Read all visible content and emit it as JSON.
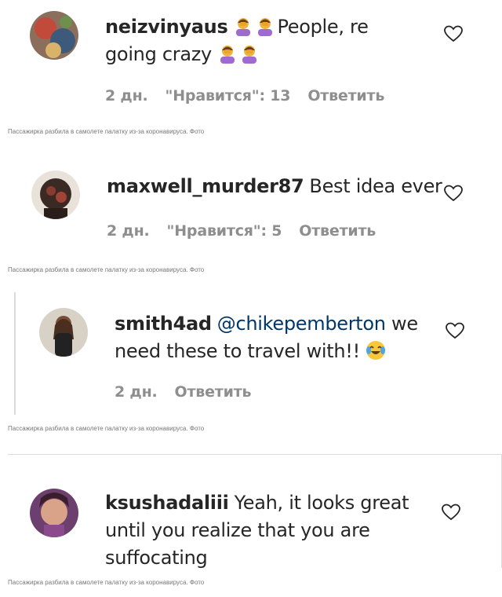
{
  "comments": [
    {
      "username": "neizvinyaus",
      "text_parts": [
        "People, re",
        "going crazy"
      ],
      "age": "2 дн.",
      "likes": "\"Нравится\": 13",
      "reply": "Ответить"
    },
    {
      "username": "maxwell_murder87",
      "text": "Best idea ever",
      "age": "2 дн.",
      "likes": "\"Нравится\": 5",
      "reply": "Ответить"
    },
    {
      "username": "smith4ad",
      "mention": "@chikepemberton",
      "text_parts": [
        "we",
        "need these to travel with!!"
      ],
      "age": "2 дн.",
      "reply": "Ответить"
    },
    {
      "username": "ksushadaliii",
      "text_lines": [
        "Yeah, it looks great",
        "until you realize that you are",
        "suffocating"
      ]
    }
  ],
  "caption": "Пассажирка разбила в самолете палатку из-за коронавируса. Фото",
  "icons": {
    "heart": "heart-outline-icon",
    "facepalm": "woman-facepalming-emoji",
    "crying": "crying-laughing-emoji"
  },
  "colors": {
    "text": "#262626",
    "meta": "#8e8e8e",
    "mention": "#00376b",
    "divider": "#dbdbdb"
  }
}
